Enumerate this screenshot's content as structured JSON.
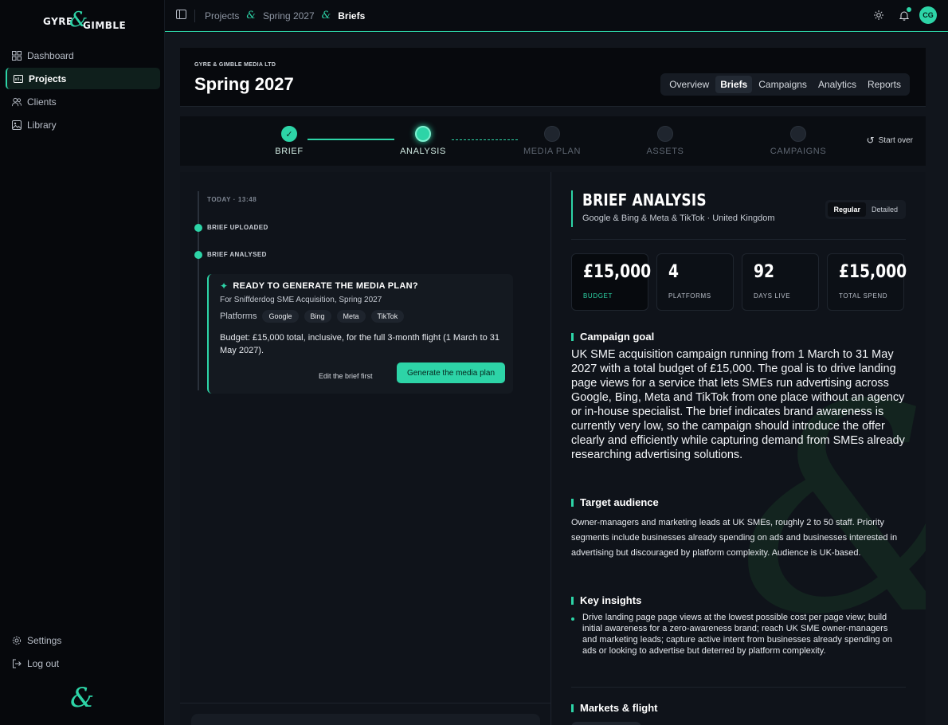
{
  "brand": {
    "word1": "GYRE",
    "word2": "GIMBLE",
    "amp": "&",
    "footer_mark": "&"
  },
  "nav": {
    "items": [
      {
        "label": "Dashboard",
        "icon": "grid-icon"
      },
      {
        "label": "Projects",
        "icon": "folder-icon"
      },
      {
        "label": "Clients",
        "icon": "users-icon"
      },
      {
        "label": "Library",
        "icon": "image-icon"
      }
    ],
    "settings": "Settings",
    "logout": "Log out"
  },
  "breadcrumb": {
    "items": [
      "Projects",
      "Spring 2027",
      "Briefs"
    ]
  },
  "user": {
    "initials": "CG"
  },
  "header": {
    "company": "GYRE & GIMBLE MEDIA LTD",
    "title": "Spring 2027",
    "tabs": [
      "Overview",
      "Briefs",
      "Campaigns",
      "Analytics",
      "Reports"
    ],
    "active_tab": "Briefs"
  },
  "stepper": {
    "steps": [
      {
        "label": "BRIEF",
        "state": "done"
      },
      {
        "label": "ANALYSIS",
        "state": "current"
      },
      {
        "label": "MEDIA PLAN",
        "state": "pending"
      },
      {
        "label": "ASSETS",
        "state": "pending"
      },
      {
        "label": "CAMPAIGNS",
        "state": "pending"
      }
    ],
    "start_over": "Start over",
    "check": "✓"
  },
  "timeline": {
    "time": "TODAY · 13:48",
    "events": [
      "BRIEF UPLOADED",
      "BRIEF ANALYSED"
    ]
  },
  "ready_card": {
    "title": "READY TO GENERATE THE MEDIA PLAN?",
    "subtitle": "For Sniffderdog SME Acquisition, Spring 2027",
    "platforms_label": "Platforms",
    "platforms": [
      "Google",
      "Bing",
      "Meta",
      "TikTok"
    ],
    "budget_label": "Budget:",
    "budget_text": "£15,000 total, inclusive, for the full 3-month flight (1 March to 31 May 2027).",
    "edit_label": "Edit the brief first",
    "generate_label": "Generate the media plan"
  },
  "analysis": {
    "title": "BRIEF ANALYSIS",
    "subtitle": "Google & Bing & Meta & TikTok · United Kingdom",
    "view_options": [
      "Regular",
      "Detailed"
    ],
    "active_view": "Regular",
    "kpis": [
      {
        "value": "£15,000",
        "label": "BUDGET"
      },
      {
        "value": "4",
        "label": "PLATFORMS"
      },
      {
        "value": "92",
        "label": "DAYS LIVE"
      },
      {
        "value": "£15,000",
        "label": "TOTAL SPEND"
      }
    ],
    "goal_heading": "Campaign goal",
    "goal_text": "UK SME acquisition campaign running from 1 March to 31 May 2027 with a total budget of £15,000. The goal is to drive landing page views for a service that lets SMEs run advertising across Google, Bing, Meta and TikTok from one place without an agency or in-house specialist. The brief indicates brand awareness is currently very low, so the campaign should introduce the offer clearly and efficiently while capturing demand from SMEs already researching advertising solutions.",
    "audience_heading": "Target audience",
    "audience_text": "Owner-managers and marketing leads at UK SMEs, roughly 2 to 50 staff. Priority segments include businesses already spending on ads and businesses interested in advertising but discouraged by platform complexity. Audience is UK-based.",
    "insights_heading": "Key insights",
    "insights": [
      "Drive landing page page views at the lowest possible cost per page view; build initial awareness for a zero-awareness brand; reach UK SME owner-managers and marketing leads; capture active intent from businesses already spending on ads or looking to advertise but deterred by platform complexity."
    ],
    "markets_heading": "Markets & flight"
  },
  "colors": {
    "accent": "#2dd4a7",
    "bg": "#0b0e14",
    "panel": "#0f131a"
  }
}
